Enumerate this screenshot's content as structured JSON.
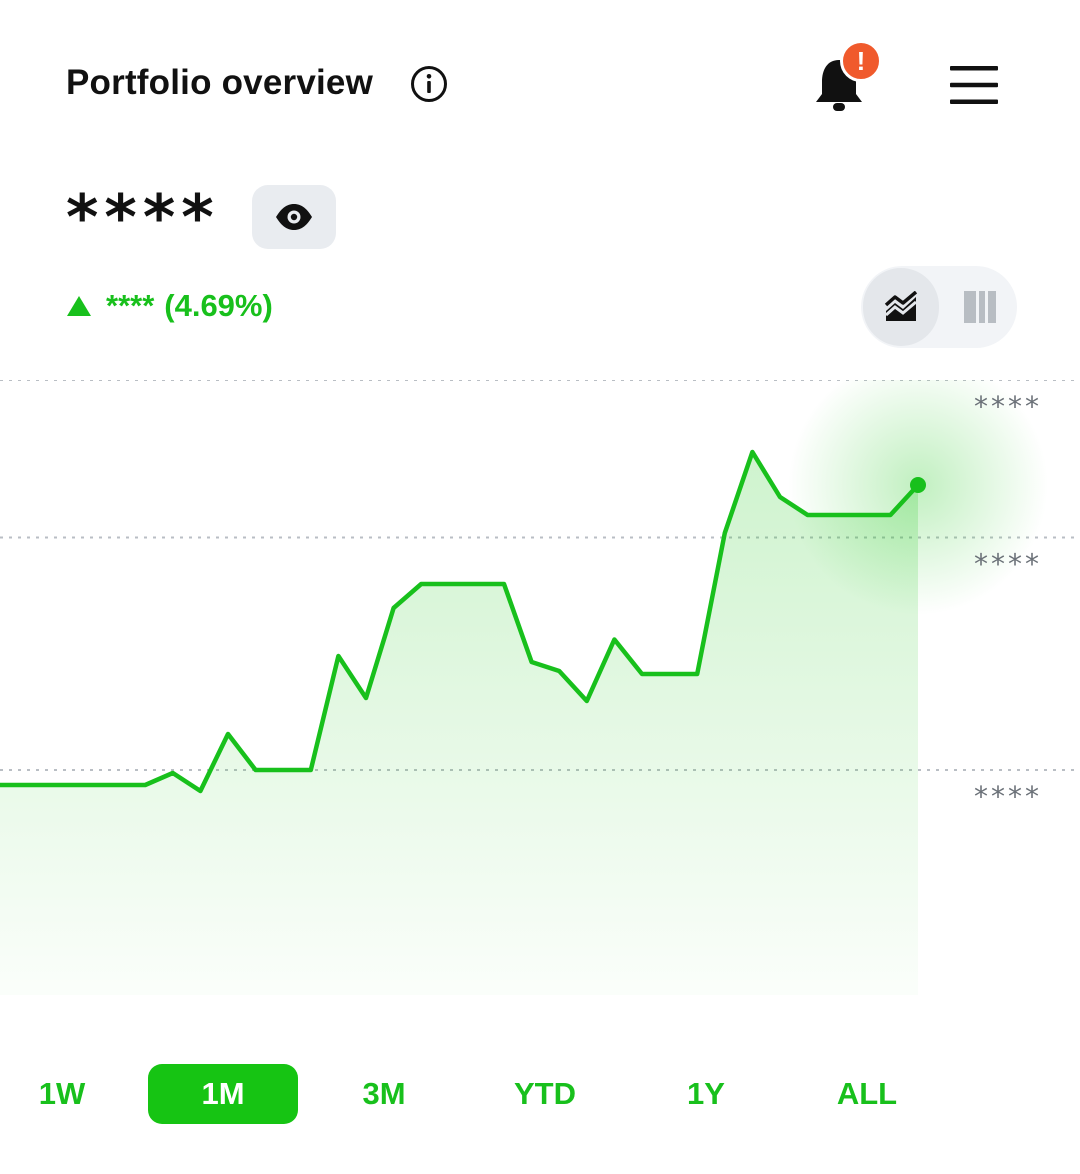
{
  "header": {
    "title": "Portfolio overview",
    "alert_badge": "!"
  },
  "balance": {
    "masked_value": "****"
  },
  "change": {
    "masked_amount": "****",
    "percent": "(4.69%)"
  },
  "colors": {
    "accent_green": "#18c01c",
    "alert_orange": "#f05a2c"
  },
  "chart_data": {
    "type": "area",
    "y_tick_labels": [
      "****",
      "****",
      "****"
    ],
    "values": [
      14,
      14,
      14,
      14.8,
      13.6,
      17.4,
      15,
      15,
      15,
      22.6,
      19.8,
      25.8,
      27.4,
      27.4,
      27.4,
      27.4,
      22.2,
      21.6,
      19.6,
      23.7,
      21.4,
      21.4,
      21.4,
      30.8,
      36.2,
      33.2,
      32,
      32,
      32,
      32,
      34
    ],
    "ylim": [
      0,
      41
    ],
    "y_gridlines": [
      41,
      30.5,
      15
    ],
    "grid": true,
    "last_point_highlighted": true
  },
  "ranges": {
    "options": [
      "1W",
      "1M",
      "3M",
      "YTD",
      "1Y",
      "ALL"
    ],
    "selected": "1M"
  }
}
